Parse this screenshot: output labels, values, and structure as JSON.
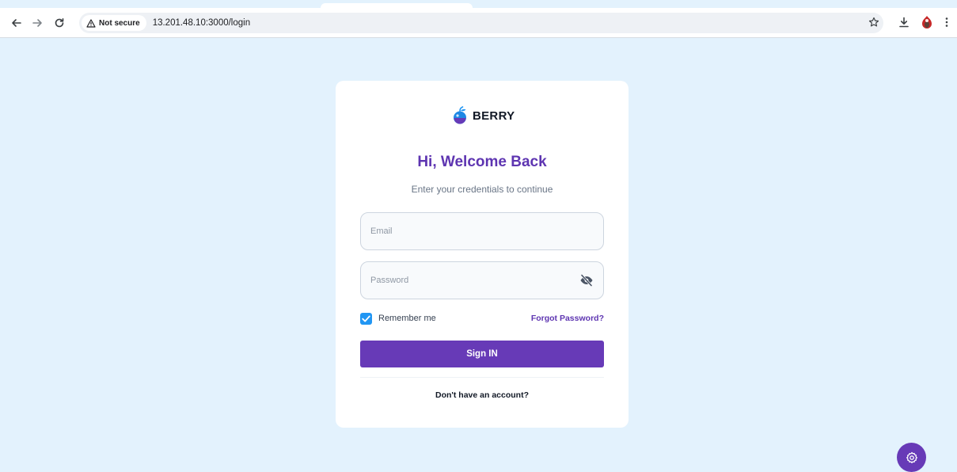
{
  "browser": {
    "security_label": "Not secure",
    "url": "13.201.48.10:3000/login"
  },
  "login": {
    "brand": "BERRY",
    "title": "Hi, Welcome Back",
    "subtitle": "Enter your credentials to continue",
    "email_placeholder": "Email",
    "email_value": "",
    "password_placeholder": "Password",
    "password_value": "",
    "remember_label": "Remember me",
    "remember_checked": true,
    "forgot_label": "Forgot Password?",
    "signin_label": "Sign IN",
    "signup_label": "Don't have an account?"
  },
  "colors": {
    "primary": "#673ab7",
    "primary_text": "#5e35b1",
    "background": "#e3f2fd",
    "checkbox": "#2196f3"
  },
  "icons": {
    "back": "arrow-left-icon",
    "forward": "arrow-right-icon",
    "reload": "reload-icon",
    "warning": "warning-triangle-icon",
    "star": "star-icon",
    "download": "download-icon",
    "profile": "profile-avatar-icon",
    "menu": "kebab-menu-icon",
    "password_toggle": "eye-off-icon",
    "settings": "gear-icon"
  }
}
